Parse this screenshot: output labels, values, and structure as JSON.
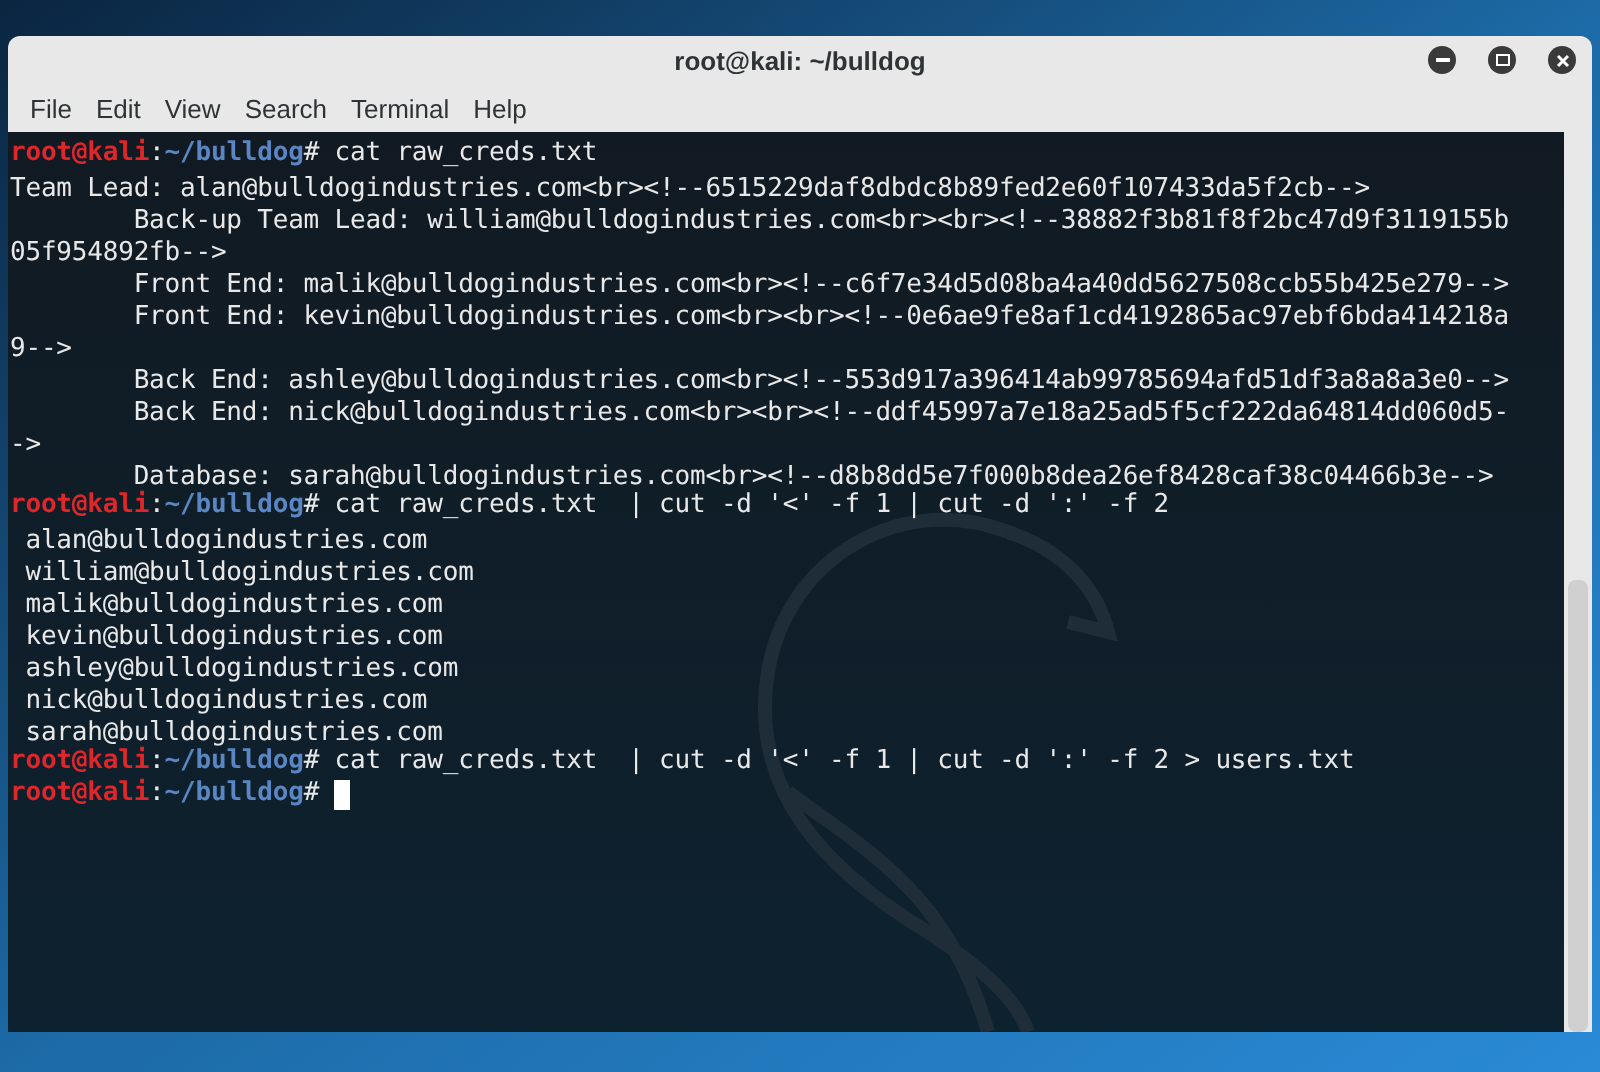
{
  "window": {
    "title": "root@kali: ~/bulldog"
  },
  "menu": [
    "File",
    "Edit",
    "View",
    "Search",
    "Terminal",
    "Help"
  ],
  "terminal": {
    "lines": [
      {
        "kind": "prompt",
        "user": "root@kali",
        "sep": ":",
        "path": "~/bulldog",
        "symbol": "#",
        "command": " cat raw_creds.txt",
        "cursor": false
      },
      {
        "kind": "output",
        "text": "Team Lead: alan@bulldogindustries.com<br><!--6515229daf8dbdc8b89fed2e60f107433da5f2cb-->"
      },
      {
        "kind": "output",
        "text": "        Back-up Team Lead: william@bulldogindustries.com<br><br><!--38882f3b81f8f2bc47d9f3119155b"
      },
      {
        "kind": "output",
        "text": "05f954892fb-->"
      },
      {
        "kind": "output",
        "text": "        Front End: malik@bulldogindustries.com<br><!--c6f7e34d5d08ba4a40dd5627508ccb55b425e279-->"
      },
      {
        "kind": "output",
        "text": "        Front End: kevin@bulldogindustries.com<br><br><!--0e6ae9fe8af1cd4192865ac97ebf6bda414218a"
      },
      {
        "kind": "output",
        "text": "9-->"
      },
      {
        "kind": "output",
        "text": "        Back End: ashley@bulldogindustries.com<br><!--553d917a396414ab99785694afd51df3a8a8a3e0-->"
      },
      {
        "kind": "output",
        "text": "        Back End: nick@bulldogindustries.com<br><br><!--ddf45997a7e18a25ad5f5cf222da64814dd060d5-"
      },
      {
        "kind": "output",
        "text": "->"
      },
      {
        "kind": "output",
        "text": "        Database: sarah@bulldogindustries.com<br><!--d8b8dd5e7f000b8dea26ef8428caf38c04466b3e-->"
      },
      {
        "kind": "prompt",
        "user": "root@kali",
        "sep": ":",
        "path": "~/bulldog",
        "symbol": "#",
        "command": " cat raw_creds.txt  | cut -d '<' -f 1 | cut -d ':' -f 2",
        "cursor": false
      },
      {
        "kind": "output",
        "text": " alan@bulldogindustries.com"
      },
      {
        "kind": "output",
        "text": " william@bulldogindustries.com"
      },
      {
        "kind": "output",
        "text": " malik@bulldogindustries.com"
      },
      {
        "kind": "output",
        "text": " kevin@bulldogindustries.com"
      },
      {
        "kind": "output",
        "text": " ashley@bulldogindustries.com"
      },
      {
        "kind": "output",
        "text": " nick@bulldogindustries.com"
      },
      {
        "kind": "output",
        "text": " sarah@bulldogindustries.com"
      },
      {
        "kind": "prompt",
        "user": "root@kali",
        "sep": ":",
        "path": "~/bulldog",
        "symbol": "#",
        "command": " cat raw_creds.txt  | cut -d '<' -f 1 | cut -d ':' -f 2 > users.txt",
        "cursor": false
      },
      {
        "kind": "prompt",
        "user": "root@kali",
        "sep": ":",
        "path": "~/bulldog",
        "symbol": "#",
        "cursor": true
      }
    ]
  }
}
